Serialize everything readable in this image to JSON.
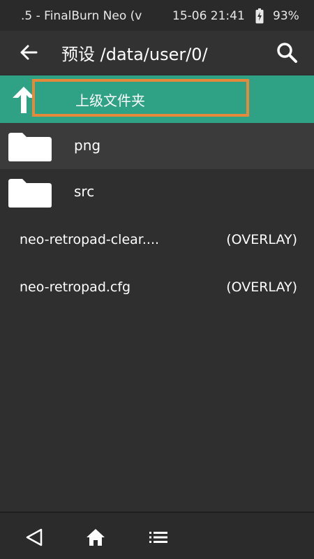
{
  "status_bar": {
    "app_text": ".5 - FinalBurn Neo (v",
    "time": "15-06 21:41",
    "battery": "93%"
  },
  "app_bar": {
    "title": "预设 /data/user/0/",
    "back_icon": "arrow-left-icon",
    "search_icon": "search-icon"
  },
  "parent_row": {
    "label": "上级文件夹",
    "icon": "arrow-up-icon"
  },
  "folders": [
    {
      "name": "png",
      "icon": "folder-icon"
    },
    {
      "name": "src",
      "icon": "folder-icon"
    }
  ],
  "files": [
    {
      "name": "neo-retropad-clear....",
      "type": "(OVERLAY)"
    },
    {
      "name": "neo-retropad.cfg",
      "type": "(OVERLAY)"
    }
  ],
  "nav": {
    "back_icon": "triangle-back-icon",
    "home_icon": "home-icon",
    "menu_icon": "list-menu-icon"
  },
  "colors": {
    "background": "#2f2f2f",
    "accent": "#2fa184",
    "highlight_border": "#e58a3a",
    "text": "#ffffff"
  }
}
